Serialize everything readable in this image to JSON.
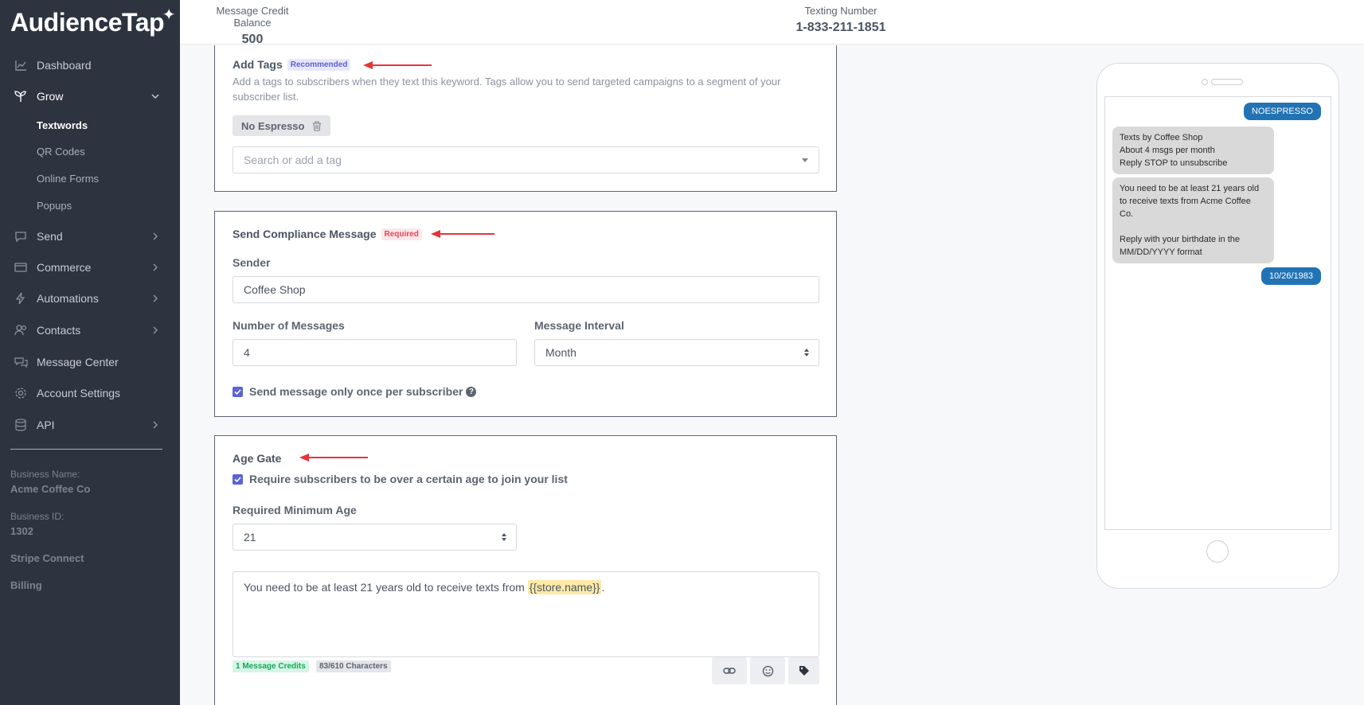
{
  "app": {
    "logo": "AudienceTap"
  },
  "topbar": {
    "credit_label": "Message Credit Balance",
    "credit_value": "500",
    "texting_label": "Texting Number",
    "texting_value": "1-833-211-1851"
  },
  "sidebar": {
    "items": [
      {
        "label": "Dashboard",
        "icon": "chart-icon"
      },
      {
        "label": "Grow",
        "icon": "sprout-icon"
      },
      {
        "label": "Send",
        "icon": "chat-icon"
      },
      {
        "label": "Commerce",
        "icon": "card-icon"
      },
      {
        "label": "Automations",
        "icon": "bolt-icon"
      },
      {
        "label": "Contacts",
        "icon": "people-icon"
      },
      {
        "label": "Message Center",
        "icon": "messages-icon"
      },
      {
        "label": "Account Settings",
        "icon": "gear-icon"
      },
      {
        "label": "API",
        "icon": "database-icon"
      }
    ],
    "grow_sub": [
      "Textwords",
      "QR Codes",
      "Online Forms",
      "Popups"
    ],
    "business_name_label": "Business Name:",
    "business_name": "Acme Coffee Co",
    "business_id_label": "Business ID:",
    "business_id": "1302",
    "stripe": "Stripe Connect",
    "billing": "Billing"
  },
  "tags": {
    "title": "Add Tags",
    "badge": "Recommended",
    "description": "Add a tags to subscribers when they text this keyword. Tags allow you to send targeted campaigns to a segment of your subscriber list.",
    "chip": "No Espresso",
    "search_placeholder": "Search or add a tag"
  },
  "compliance": {
    "title": "Send Compliance Message",
    "badge": "Required",
    "sender_label": "Sender",
    "sender_value": "Coffee Shop",
    "num_label": "Number of Messages",
    "num_value": "4",
    "interval_label": "Message Interval",
    "interval_value": "Month",
    "once_label": "Send message only once per subscriber"
  },
  "age_gate": {
    "title": "Age Gate",
    "require_label": "Require subscribers to be over a certain age to join your list",
    "min_age_label": "Required Minimum Age",
    "min_age_value": "21",
    "message_prefix": "You need to be at least 21 years old to receive texts from ",
    "message_token": "{{store.name}}",
    "message_suffix": ".",
    "credits": "1 Message Credits",
    "chars": "83/610 Characters"
  },
  "preview": {
    "keyword": "NOESPRESSO",
    "reply1": [
      "Texts by Coffee Shop",
      "About 4 msgs per month",
      "Reply STOP to unsubscribe"
    ],
    "reply2a": "You need to be at least 21 years old to receive texts from Acme Coffee Co.",
    "reply2b": "Reply with your birthdate in the MM/DD/YYYY format",
    "birthdate": "10/26/1983"
  },
  "colors": {
    "sidebar_bg": "#2d3440",
    "accent": "#5b63d6",
    "bubble_out": "#2273b4",
    "arrow": "#e8333b"
  }
}
